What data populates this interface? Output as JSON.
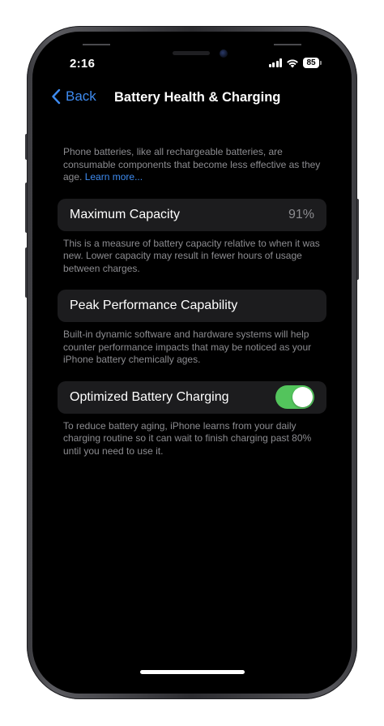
{
  "status_bar": {
    "time": "2:16",
    "battery_level": "85",
    "signal_icon": "cellular-signal-icon",
    "wifi_icon": "wifi-icon"
  },
  "nav": {
    "back_label": "Back",
    "title": "Battery Health & Charging"
  },
  "intro": {
    "text": "Phone batteries, like all rechargeable batteries, are consumable components that become less effective as they age.",
    "link": "Learn more..."
  },
  "maximum_capacity": {
    "label": "Maximum Capacity",
    "value": "91%",
    "description": "This is a measure of battery capacity relative to when it was new. Lower capacity may result in fewer hours of usage between charges."
  },
  "peak_performance": {
    "label": "Peak Performance Capability",
    "description": "Built-in dynamic software and hardware systems will help counter performance impacts that may be noticed as your iPhone battery chemically ages."
  },
  "optimized_charging": {
    "label": "Optimized Battery Charging",
    "enabled": true,
    "description": "To reduce battery aging, iPhone learns from your daily charging routine so it can wait to finish charging past 80% until you need to use it."
  },
  "colors": {
    "accent": "#3e8bf0",
    "toggle_on": "#53c45c",
    "cell_background": "#1c1c1e",
    "secondary_text": "#8c8c90"
  }
}
